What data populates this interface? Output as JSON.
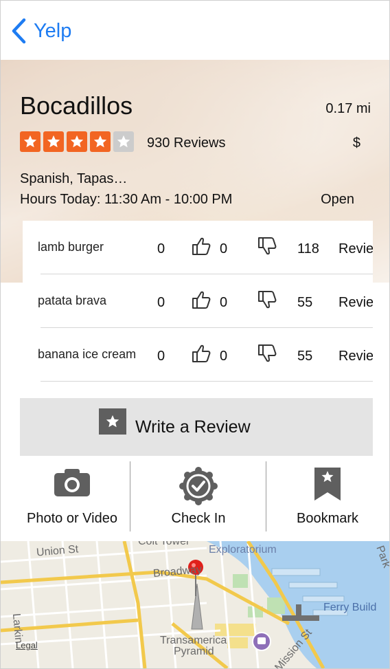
{
  "nav": {
    "back_label": "Yelp"
  },
  "business": {
    "name": "Bocadillos",
    "distance": "0.17 mi",
    "rating_stars": 4,
    "rating_max": 5,
    "review_count": "930 Reviews",
    "price": "$",
    "categories": "Spanish, Tapas…",
    "hours": "Hours Today: 11:30 Am - 10:00 PM",
    "open_status": "Open"
  },
  "dishes": [
    {
      "name": "lamb burger",
      "count1": "0",
      "count2": "0",
      "reviews": "118",
      "link": "Reviews"
    },
    {
      "name": "patata brava",
      "count1": "0",
      "count2": "0",
      "reviews": "55",
      "link": "Reviews"
    },
    {
      "name": "banana ice cream",
      "count1": "0",
      "count2": "0",
      "reviews": "55",
      "link": "Reviews"
    }
  ],
  "write_review": {
    "label": "Write a Review",
    "icon": "star-square-icon"
  },
  "actions": [
    {
      "label": "Photo or Video",
      "icon": "camera-icon"
    },
    {
      "label": "Check In",
      "icon": "checkin-badge-icon"
    },
    {
      "label": "Bookmark",
      "icon": "bookmark-icon"
    }
  ],
  "map": {
    "labels": {
      "union_st": "Union St",
      "exploratorium": "Exploratorium",
      "broadway": "Broadway",
      "park": "Park",
      "ferry_building": "Ferry Build",
      "larkin": "Larkin",
      "legal": "Legal",
      "transamerica": "Transamerica",
      "pyramid": "Pyramid",
      "mission_st": "Mission St",
      "coit_tower": "Coit Tower"
    }
  },
  "colors": {
    "accent": "#1e7cf2",
    "star_on": "#f26522",
    "star_off": "#cccccc",
    "pin": "#e0201b"
  }
}
